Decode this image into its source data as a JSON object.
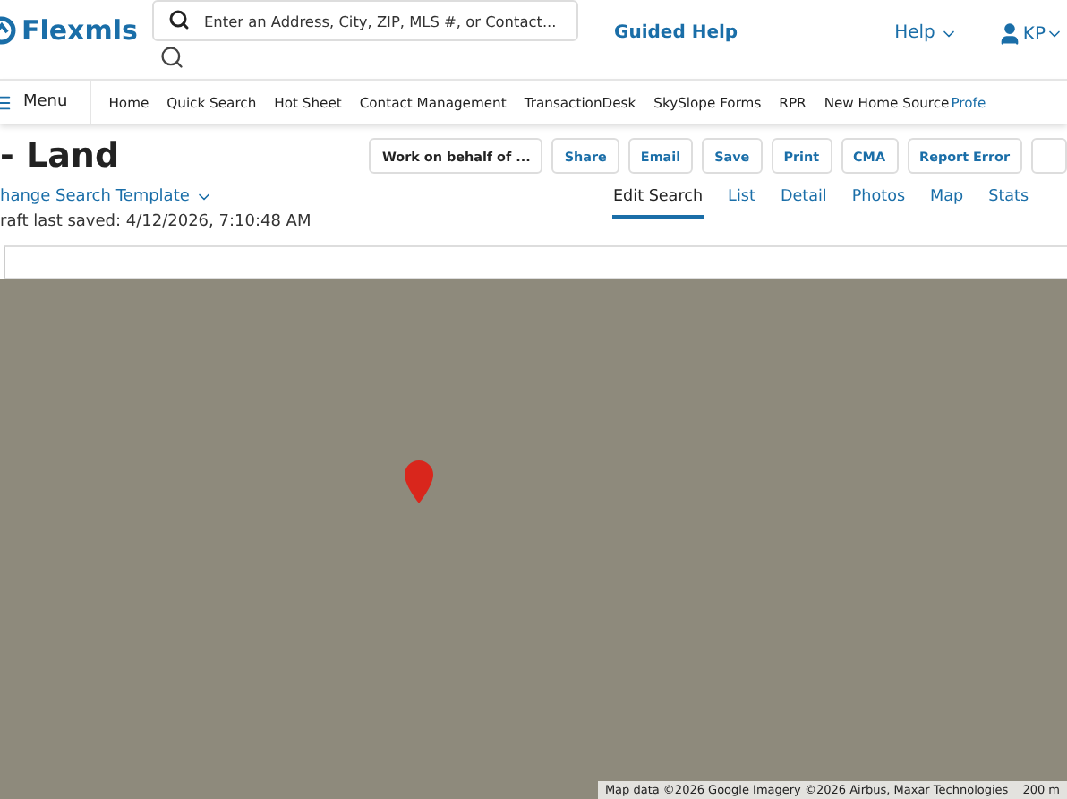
{
  "header": {
    "logo": "Flexmls",
    "search": {
      "placeholder": "Enter an Address, City, ZIP, MLS #, or Contact..."
    },
    "guided_help": "Guided Help",
    "help": "Help",
    "user": "KP"
  },
  "nav": {
    "menu": "Menu",
    "items": [
      "Home",
      "Quick Search",
      "Hot Sheet",
      "Contact Management",
      "TransactionDesk",
      "SkySlope Forms",
      "RPR",
      "New Home Source",
      "Profe"
    ]
  },
  "page": {
    "title": "- Land",
    "template": "hange Search Template",
    "draft": "raft last saved: 4/12/2026, 7:10:48 AM"
  },
  "actions": [
    "Work on behalf of ...",
    "Share",
    "Email",
    "Save",
    "Print",
    "CMA",
    "Report Error"
  ],
  "tabs": [
    {
      "label": "Edit Search",
      "selected": true
    },
    {
      "label": "List",
      "selected": false
    },
    {
      "label": "Detail",
      "selected": false
    },
    {
      "label": "Photos",
      "selected": false
    },
    {
      "label": "Map",
      "selected": false
    },
    {
      "label": "Stats",
      "selected": false
    }
  ],
  "map": {
    "attribution": "Map data ©2026 Google Imagery ©2026 Airbus, Maxar Technologies",
    "scale": "200 m"
  }
}
